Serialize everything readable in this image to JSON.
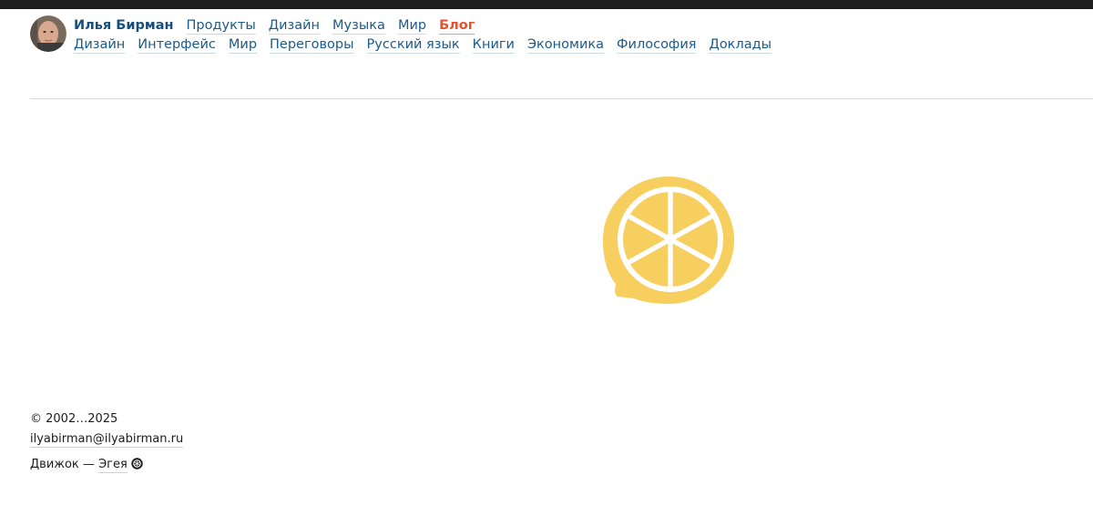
{
  "header": {
    "name": "Илья Бирман",
    "main_nav": [
      "Продукты",
      "Дизайн",
      "Музыка",
      "Мир"
    ],
    "active": "Блог",
    "sub_nav": [
      "Дизайн",
      "Интерфейс",
      "Мир",
      "Переговоры",
      "Русский язык",
      "Книги",
      "Экономика",
      "Философия",
      "Доклады"
    ]
  },
  "logo": {
    "icon": "lemon-icon",
    "color": "#f7cf5f"
  },
  "footer": {
    "copyright": "© 2002…2025",
    "email": "ilyabirman@ilyabirman.ru",
    "engine_prefix": "Движок — ",
    "engine_name": "Эгея"
  },
  "colors": {
    "link": "#1b5a8c",
    "active": "#e5532e",
    "topbar": "#1e1e1e"
  }
}
